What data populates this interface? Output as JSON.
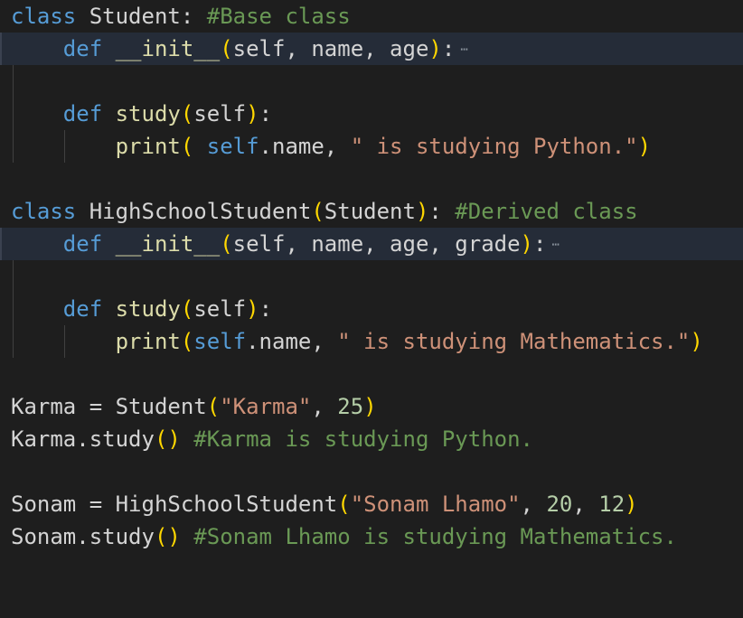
{
  "editor": {
    "theme_colors": {
      "background": "#1e1e1e",
      "keyword": "#569cd6",
      "string": "#ce9178",
      "comment": "#6a9955",
      "number": "#b5cea8",
      "bracket": "#ffd700",
      "folded_line_bg": "#252c38"
    },
    "fold_icon": "ellipsis-icon",
    "lines": {
      "l1": {
        "kw": "class",
        "name": " Student:",
        "comment": " #Base class"
      },
      "l2": {
        "indent": "    ",
        "kw": "def",
        "sp": " ",
        "fn": "__init__",
        "open": "(",
        "params": "self, name, age",
        "close": ")",
        "colon": ":",
        "fold": "⋯"
      },
      "l4": {
        "indent": "    ",
        "kw": "def",
        "sp": " ",
        "fn": "study",
        "open": "(",
        "params": "self",
        "close": ")",
        "colon": ":"
      },
      "l5": {
        "indent": "        ",
        "fn": "print",
        "open": "(",
        "sp": " ",
        "self": "self",
        "rest": ".name, ",
        "str": "\" is studying Python.\"",
        "close": ")"
      },
      "l7": {
        "kw": "class",
        "name": " HighSchoolStudent",
        "open": "(",
        "base": "Student",
        "close": ")",
        "colon": ":",
        "comment": " #Derived class"
      },
      "l8": {
        "indent": "    ",
        "kw": "def",
        "sp": " ",
        "fn": "__init__",
        "open": "(",
        "params": "self, name, age, grade",
        "close": ")",
        "colon": ":",
        "fold": "⋯"
      },
      "l10": {
        "indent": "    ",
        "kw": "def",
        "sp": " ",
        "fn": "study",
        "open": "(",
        "params": "self",
        "close": ")",
        "colon": ":"
      },
      "l11": {
        "indent": "        ",
        "fn": "print",
        "open": "(",
        "self": "self",
        "rest": ".name, ",
        "str": "\" is studying Mathematics.\"",
        "close": ")"
      },
      "l13": {
        "var": "Karma",
        "eq": " = ",
        "cls": "Student",
        "open": "(",
        "str": "\"Karma\"",
        "sep": ", ",
        "num": "25",
        "close": ")"
      },
      "l14": {
        "var": "Karma",
        "call": ".study",
        "parens": "()",
        "comment": " #Karma is studying Python."
      },
      "l16": {
        "var": "Sonam",
        "eq": " = ",
        "cls": "HighSchoolStudent",
        "open": "(",
        "str": "\"Sonam Lhamo\"",
        "sep1": ", ",
        "num1": "20",
        "sep2": ", ",
        "num2": "12",
        "close": ")"
      },
      "l17": {
        "var": "Sonam",
        "call": ".study",
        "parens": "()",
        "comment": " #Sonam Lhamo is studying Mathematics."
      }
    }
  }
}
